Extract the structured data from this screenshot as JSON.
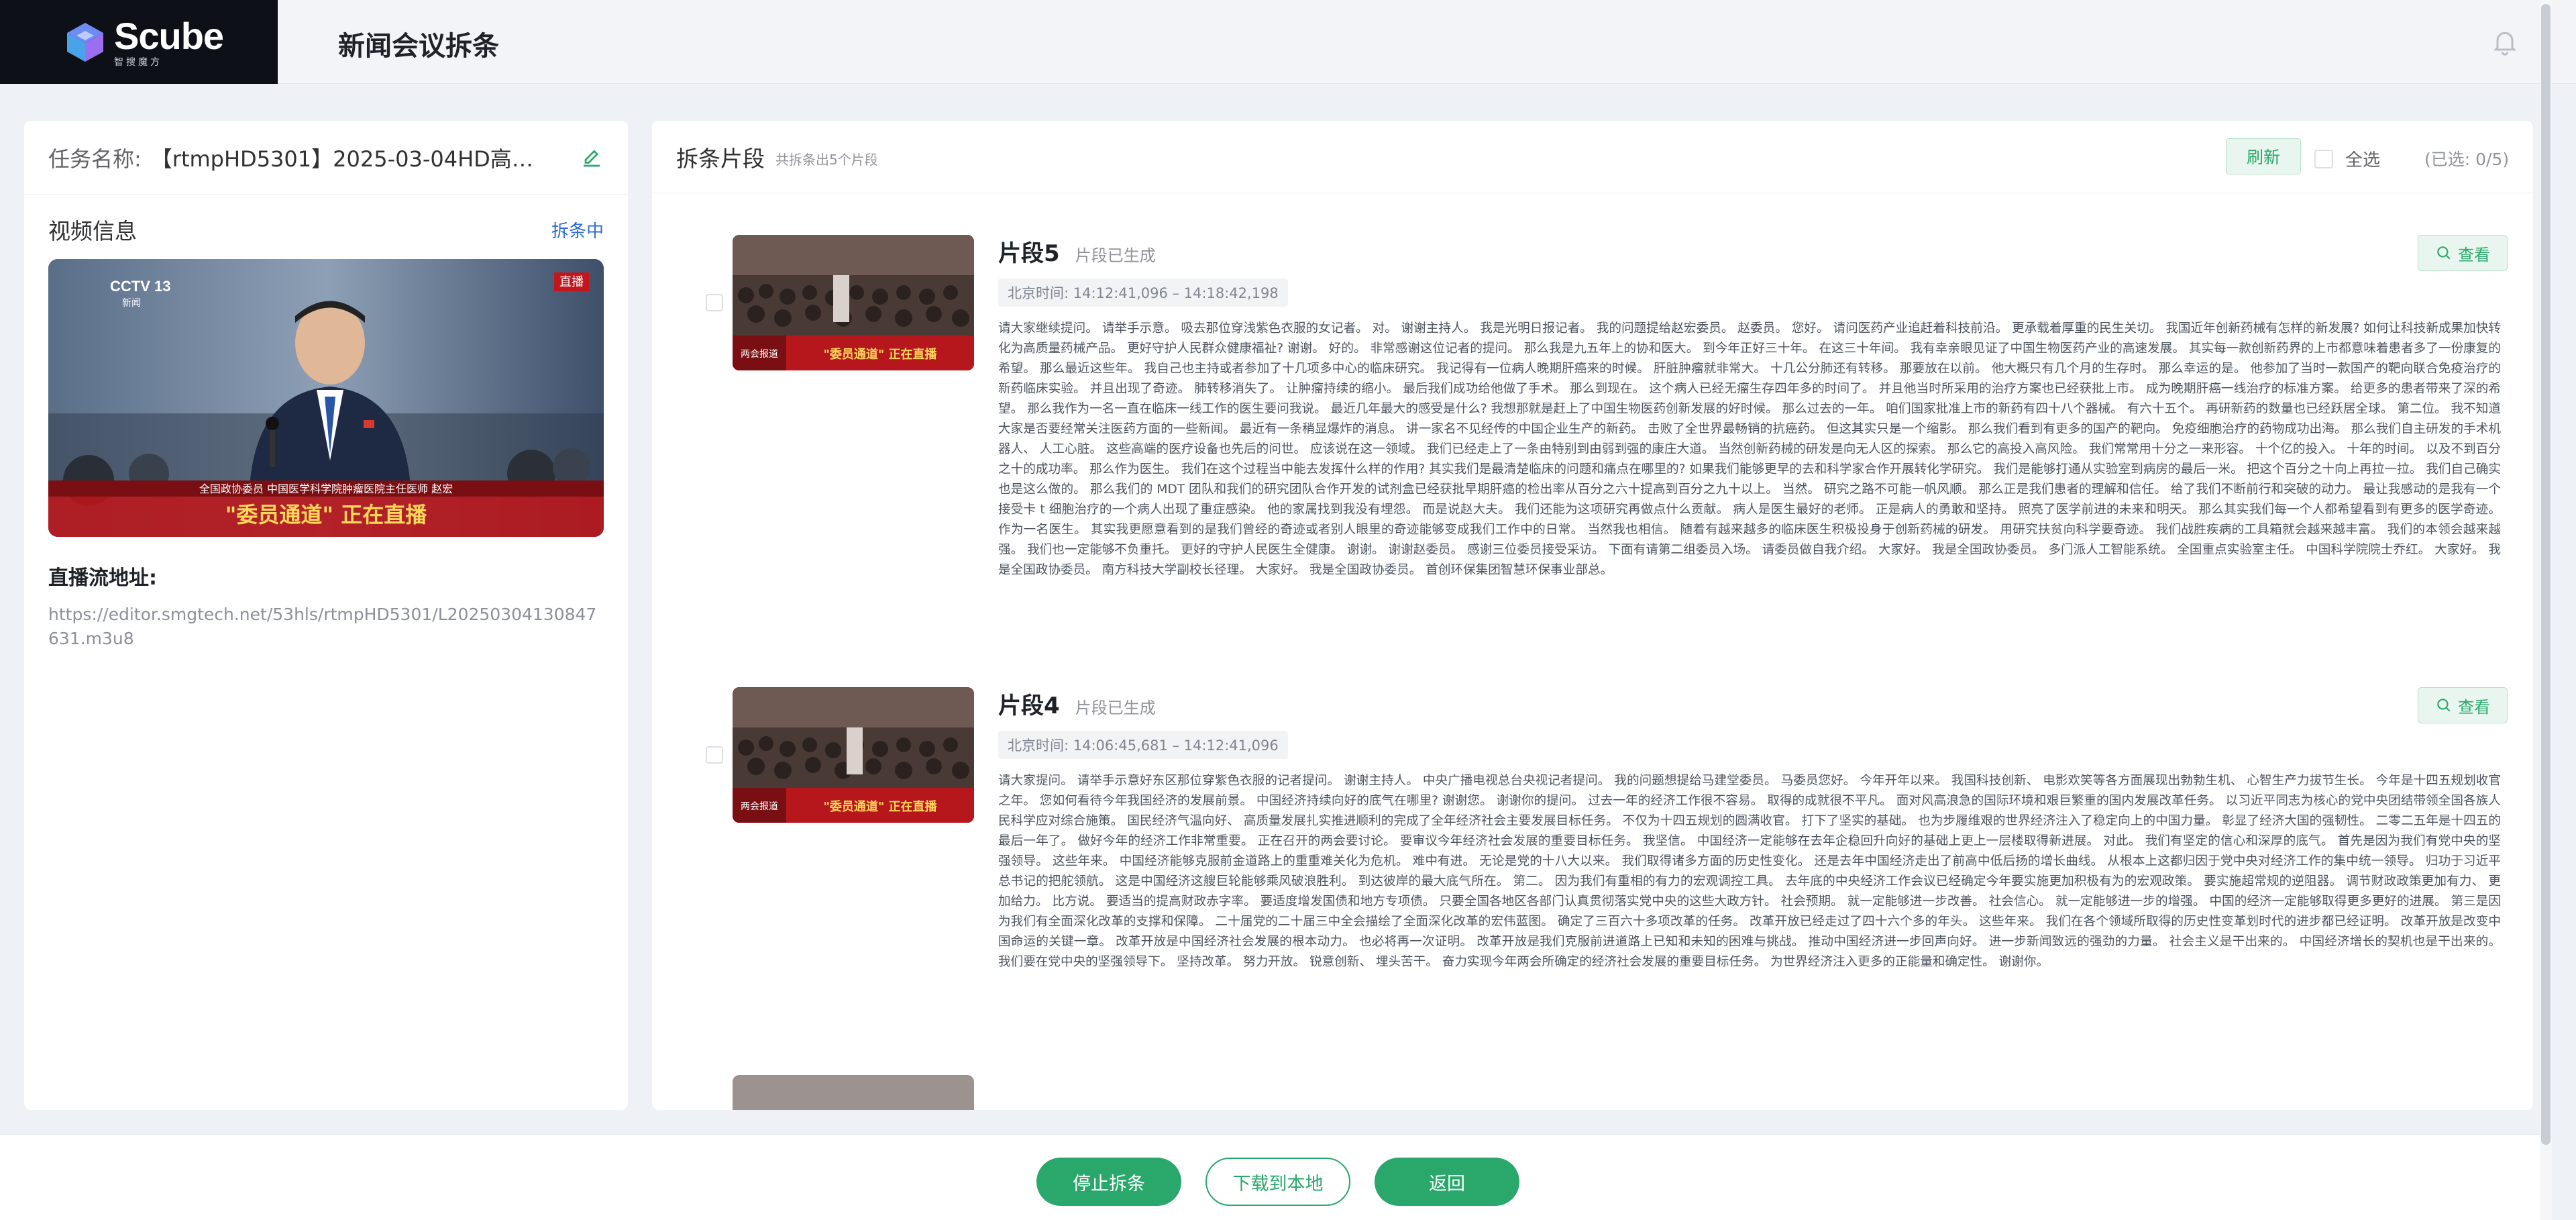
{
  "header": {
    "logo_name": "Scube",
    "logo_sub": "智搜魔方",
    "page_title": "新闻会议拆条"
  },
  "task": {
    "label": "任务名称:",
    "value": "【rtmpHD5301】2025-03-04HD高清..."
  },
  "video": {
    "title": "视频信息",
    "status": "拆条中",
    "channel_logo": "CCTV 13",
    "channel_sub": "新闻",
    "live_badge": "直播",
    "banner_small": "全国政协委员 中国医学科学院肿瘤医院主任医师 赵宏",
    "banner_big": "\"委员通道\" 正在直播"
  },
  "stream": {
    "label": "直播流地址:",
    "url": "https://editor.smgtech.net/53hls/rtmpHD5301/L20250304130847631.m3u8"
  },
  "segments_panel": {
    "title": "拆条片段",
    "count_text": "共拆条出5个片段",
    "refresh_label": "刷新",
    "select_all_label": "全选",
    "selected_count": "(已选: 0/5)"
  },
  "segments": [
    {
      "name": "片段5",
      "status": "片段已生成",
      "time": "北京时间: 14:12:41,096 – 14:18:42,198",
      "thumb_banner": "\"委员通道\" 正在直播",
      "thumb_tag": "两会报道",
      "view_label": "查看",
      "text": "请大家继续提问。 请举手示意。 吸去那位穿浅紫色衣服的女记者。 对。 谢谢主持人。 我是光明日报记者。 我的问题提给赵宏委员。 赵委员。 您好。 请问医药产业追赶着科技前沿。 更承载着厚重的民生关切。 我国近年创新药械有怎样的新发展? 如何让科技新成果加快转化为高质量药械产品。 更好守护人民群众健康福祉? 谢谢。 好的。 非常感谢这位记者的提问。 那么我是九五年上的协和医大。 到今年正好三十年。 在这三十年间。 我有幸亲眼见证了中国生物医药产业的高速发展。 其实每一款创新药界的上市都意味着患者多了一份康复的希望。 那么最近这些年。 我自己也主持或者参加了十几项多中心的临床研究。 我记得有一位病人晚期肝癌来的时候。 肝脏肿瘤就非常大。 十几公分肺还有转移。 那要放在以前。 他大概只有几个月的生存时。 那么幸运的是。 他参加了当时一款国产的靶向联合免疫治疗的新药临床实验。 并且出现了奇迹。 肺转移消失了。 让肿瘤持续的缩小。 最后我们成功给他做了手术。 那么到现在。 这个病人已经无瘤生存四年多的时间了。 并且他当时所采用的治疗方案也已经获批上市。 成为晚期肝癌一线治疗的标准方案。 给更多的患者带来了深的希望。 那么我作为一名一直在临床一线工作的医生要问我说。 最近几年最大的感受是什么? 我想那就是赶上了中国生物医药创新发展的好时候。 那么过去的一年。 咱们国家批准上市的新药有四十八个器械。 有六十五个。 再研新药的数量也已经跃居全球。 第二位。 我不知道大家是否要经常关注医药方面的一些新闻。 最近有一条稍显爆炸的消息。 讲一家名不见经传的中国企业生产的新药。 击败了全世界最畅销的抗癌药。 但这其实只是一个缩影。 那么我们看到有更多的国产的靶向。 免疫细胞治疗的药物成功出海。 那么我们自主研发的手术机器人、 人工心脏。 这些高端的医疗设备也先后的问世。 应该说在这一领域。 我们已经走上了一条由特别到由弱到强的康庄大道。 当然创新药械的研发是向无人区的探索。 那么它的高投入高风险。 我们常常用十分之一来形容。 十个亿的投入。 十年的时间。 以及不到百分之十的成功率。 那么作为医生。 我们在这个过程当中能去发挥什么样的作用? 其实我们是最清楚临床的问题和痛点在哪里的? 如果我们能够更早的去和科学家合作开展转化学研究。 我们是能够打通从实验室到病房的最后一米。 把这个百分之十向上再拉一拉。 我们自己确实也是这么做的。 那么我们的 MDT 团队和我们的研究团队合作开发的试剂盒已经获批早期肝癌的检出率从百分之六十提高到百分之九十以上。 当然。 研究之路不可能一帆风顺。 那么正是我们患者的理解和信任。 给了我们不断前行和突破的动力。 最让我感动的是我有一个接受卡 t 细胞治疗的一个病人出现了重症感染。 他的家属找到我没有埋怨。 而是说赵大夫。 我们还能为这项研究再做点什么贡献。 病人是医生最好的老师。 正是病人的勇敢和坚持。 照亮了医学前进的未来和明天。 那么其实我们每一个人都希望看到有更多的医学奇迹。 作为一名医生。 其实我更愿意看到的是我们曾经的奇迹或者别人眼里的奇迹能够变成我们工作中的日常。 当然我也相信。 随着有越来越多的临床医生积极投身于创新药械的研发。 用研究扶贫向科学要奇迹。 我们战胜疾病的工具箱就会越来越丰富。 我们的本领会越来越强。 我们也一定能够不负重托。 更好的守护人民医生全健康。 谢谢。 谢谢赵委员。 感谢三位委员接受采访。 下面有请第二组委员入场。 请委员做自我介绍。 大家好。 我是全国政协委员。 多门派人工智能系统。 全国重点实验室主任。 中国科学院院士乔红。 大家好。 我是全国政协委员。 南方科技大学副校长径理。 大家好。 我是全国政协委员。 首创环保集团智慧环保事业部总。"
    },
    {
      "name": "片段4",
      "status": "片段已生成",
      "time": "北京时间: 14:06:45,681 – 14:12:41,096",
      "thumb_banner": "\"委员通道\" 正在直播",
      "thumb_tag": "两会报道",
      "view_label": "查看",
      "text": "请大家提问。 请举手示意好东区那位穿紫色衣服的记者提问。 谢谢主持人。 中央广播电视总台央视记者提问。 我的问题想提给马建堂委员。 马委员您好。 今年开年以来。 我国科技创新、 电影欢笑等各方面展现出勃勃生机、 心智生产力拔节生长。 今年是十四五规划收官之年。 您如何看待今年我国经济的发展前景。 中国经济持续向好的底气在哪里? 谢谢您。 谢谢你的提问。 过去一年的经济工作很不容易。 取得的成就很不平凡。 面对风高浪急的国际环境和艰巨繁重的国内发展改革任务。 以习近平同志为核心的党中央团结带领全国各族人民科学应对综合施策。 国民经济气温向好、 高质量发展扎实推进顺利的完成了全年经济社会主要发展目标任务。 不仅为十四五规划的圆满收官。 打下了坚实的基础。 也为步履维艰的世界经济注入了稳定向上的中国力量。 彰显了经济大国的强韧性。 二零二五年是十四五的最后一年了。 做好今年的经济工作非常重要。 正在召开的两会要讨论。 要审议今年经济社会发展的重要目标任务。 我坚信。 中国经济一定能够在去年企稳回升向好的基础上更上一层楼取得新进展。 对此。 我们有坚定的信心和深厚的底气。 首先是因为我们有党中央的坚强领导。 这些年来。 中国经济能够克服前金道路上的重重难关化为危机。 难中有进。 无论是党的十八大以来。 我们取得诸多方面的历史性变化。 还是去年中国经济走出了前高中低后扬的增长曲线。 从根本上这都归因于党中央对经济工作的集中统一领导。 归功于习近平总书记的把舵领航。 这是中国经济这艘巨轮能够乘风破浪胜利。 到达彼岸的最大底气所在。 第二。 因为我们有重相的有力的宏观调控工具。 去年底的中央经济工作会议已经确定今年要实施更加积极有为的宏观政策。 要实施超常规的逆阻器。 调节财政政策更加有力、 更加给力。 比方说。 要适当的提高财政赤字率。 要适度增发国债和地方专项债。 只要全国各地区各部门认真贯彻落实党中央的这些大政方针。 社会预期。 就一定能够进一步改善。 社会信心。 就一定能够进一步的增强。 中国的经济一定能够取得更多更好的进展。 第三是因为我们有全面深化改革的支撑和保障。 二十届党的二十届三中全会描绘了全面深化改革的宏伟蓝图。 确定了三百六十多项改革的任务。 改革开放已经走过了四十六个多的年头。 这些年来。 我们在各个领域所取得的历史性变革划时代的进步都已经证明。 改革开放是改变中国命运的关键一章。 改革开放是中国经济社会发展的根本动力。 也必将再一次证明。 改革开放是我们克服前进道路上已知和未知的困难与挑战。 推动中国经济进一步回声向好。 进一步新闻致远的强劲的力量。 社会主义是干出来的。 中国经济增长的契机也是干出来的。 我们要在党中央的坚强领导下。 坚持改革。 努力开放。 锐意创新、 埋头苦干。 奋力实现今年两会所确定的经济社会发展的重要目标任务。 为世界经济注入更多的正能量和确定性。 谢谢你。"
    }
  ],
  "footer": {
    "stop_label": "停止拆条",
    "download_label": "下载到本地",
    "back_label": "返回"
  },
  "colors": {
    "accent": "#2aa86b",
    "link": "#2f6bd8",
    "background": "#eef1f5"
  }
}
